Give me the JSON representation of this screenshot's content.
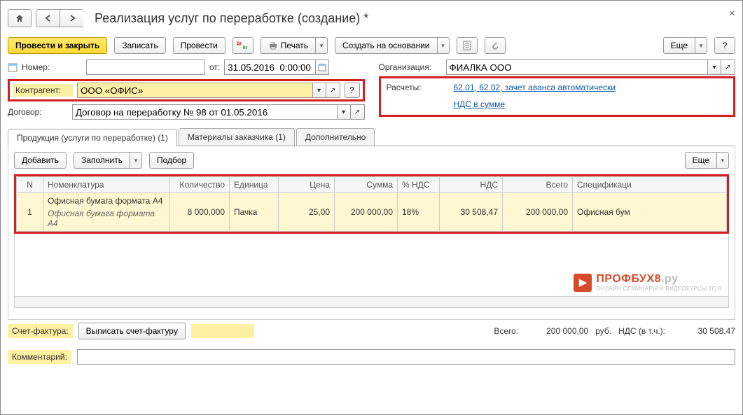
{
  "title": "Реализация услуг по переработке (создание) *",
  "toolbar": {
    "post_close": "Провести и закрыть",
    "save": "Записать",
    "post": "Провести",
    "print": "Печать",
    "create_based": "Создать на основании",
    "more": "Еще",
    "help": "?"
  },
  "fields": {
    "number_label": "Номер:",
    "number_value": "",
    "date_label": "от:",
    "date_value": "31.05.2016  0:00:00",
    "org_label": "Организация:",
    "org_value": "ФИАЛКА ООО",
    "counterparty_label": "Контрагент:",
    "counterparty_value": "ООО «ОФИС»",
    "contract_label": "Договор:",
    "contract_value": "Договор на переработку № 98 от 01.05.2016",
    "calc_label": "Расчеты:",
    "calc_link": "62.01, 62.02, зачет аванса автоматически",
    "vat_link": "НДС в сумме"
  },
  "tabs": {
    "t1": "Продукция (услуги по переработке) (1)",
    "t2": "Материалы заказчика (1)",
    "t3": "Дополнительно"
  },
  "tabbar": {
    "add": "Добавить",
    "fill": "Заполнить",
    "select": "Подбор",
    "more": "Еще"
  },
  "grid": {
    "headers": {
      "n": "N",
      "nomen": "Номенклатура",
      "qty": "Количество",
      "unit": "Единица",
      "price": "Цена",
      "sum": "Сумма",
      "vatp": "% НДС",
      "vat": "НДС",
      "total": "Всего",
      "spec": "Спецификаци"
    },
    "rows": [
      {
        "n": "1",
        "nomen": "Офисная бумага формата А4",
        "nomen2": "Офисная бумага формата А4",
        "qty": "8 000,000",
        "unit": "Пачка",
        "price": "25,00",
        "sum": "200 000,00",
        "vatp": "18%",
        "vat": "30 508,47",
        "total": "200 000,00",
        "spec": "Офисная бум"
      }
    ]
  },
  "watermark": {
    "brand": "ПРОФБУХ8",
    "suffix": ".ру",
    "tagline": "ОНЛАЙН СЕМИНАРЫ И ВИДЕОКУРСЫ 1С:8"
  },
  "footer": {
    "invoice_label": "Счет-фактура:",
    "invoice_btn": "Выписать счет-фактуру",
    "total_label": "Всего:",
    "total_value": "200 000,00",
    "currency": "руб.",
    "vat_label": "НДС (в т.ч.):",
    "vat_value": "30 508,47",
    "comment_label": "Комментарий:",
    "comment_value": ""
  }
}
